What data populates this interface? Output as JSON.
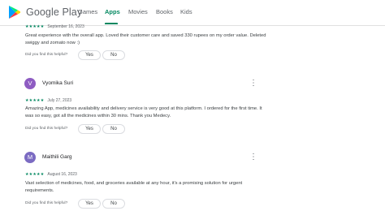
{
  "header": {
    "brand": "Google Play",
    "nav": [
      "Games",
      "Apps",
      "Movies",
      "Books",
      "Kids"
    ],
    "active_tab": "Apps",
    "accent_color": "#01875f"
  },
  "reviews": [
    {
      "stars": "★★★★★",
      "rating": 5,
      "date": "September 16, 2023",
      "text": "Great experience with the overall app. Loved their customer care and saved 330 rupees on my order value. Deleted swiggy and zomato now :)",
      "helpful_label": "Did you find this helpful?",
      "yes_label": "Yes",
      "no_label": "No"
    },
    {
      "initial": "V",
      "avatar_color": "#8e5cc2",
      "name": "Vyomika Suri",
      "more_icon": "⋮",
      "stars": "★★★★★",
      "rating": 5,
      "date": "July 27, 2023",
      "text": "Amazing App, medicines availability and delivery service is very good at this platform. I ordered for the first time. It was so easy, got all the medicines within 30 mins. Thank you Medecy.",
      "helpful_label": "Did you find this helpful?",
      "yes_label": "Yes",
      "no_label": "No"
    },
    {
      "initial": "M",
      "avatar_color": "#7b6bc2",
      "name": "Maithili Garg",
      "more_icon": "⋮",
      "stars": "★★★★★",
      "rating": 5,
      "date": "August 16, 2023",
      "text": "Vast selection of medicines, food, and groceries available at any hour, it's a promising solution for urgent requirements.",
      "helpful_label": "Did you find this helpful?",
      "yes_label": "Yes",
      "no_label": "No"
    }
  ]
}
